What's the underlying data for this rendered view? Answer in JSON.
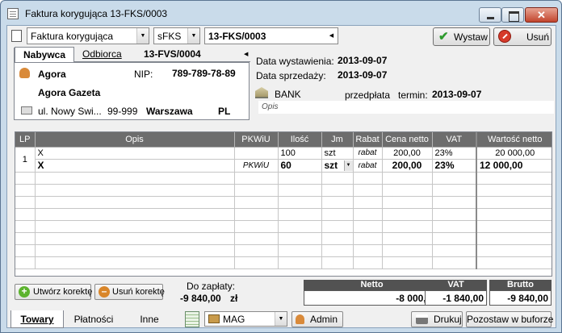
{
  "window": {
    "title": "Faktura korygująca 13-FKS/0003"
  },
  "toolbar": {
    "doc_type": "Faktura korygująca",
    "series": "sFKS",
    "number": "13-FKS/0003",
    "issue_label": "Wystaw",
    "cancel_label": "Usuń"
  },
  "party_tabs": {
    "buyer": "Nabywca",
    "recipient": "Odbiorca",
    "doc_ref": "13-FVS/0004"
  },
  "buyer": {
    "name": "Agora",
    "nip_label": "NIP:",
    "nip": "789-789-78-89",
    "full_name": "Agora Gazeta",
    "street": "ul. Nowy Swi...",
    "postcode": "99-999",
    "city": "Warszawa",
    "country": "PL"
  },
  "dates": {
    "issue_label": "Data wystawienia:",
    "issue_value": "2013-09-07",
    "sale_label": "Data sprzedaży:",
    "sale_value": "2013-09-07"
  },
  "payment": {
    "method": "BANK",
    "form": "przedpłata",
    "term_label": "termin:",
    "term_value": "2013-09-07",
    "desc_placeholder": "Opis"
  },
  "grid": {
    "headers": [
      "LP",
      "Opis",
      "PKWiU",
      "Ilość",
      "Jm",
      "Rabat",
      "Cena netto",
      "VAT",
      "Wartość netto"
    ],
    "row_lp": "1",
    "original": {
      "opis": "X",
      "pkwiu": "",
      "ilosc": "100",
      "jm": "szt",
      "rabat": "rabat",
      "cena": "200,00",
      "vat": "23%",
      "wartosc": "20 000,00"
    },
    "corrected": {
      "opis": "X",
      "pkwiu": "PKWiU",
      "ilosc": "60",
      "jm": "szt",
      "rabat": "rabat",
      "cena": "200,00",
      "vat": "23%",
      "wartosc": "12 000,00"
    }
  },
  "correction": {
    "create_label": "Utwórz korektę",
    "delete_label": "Usuń korektę"
  },
  "to_pay": {
    "label": "Do zapłaty:",
    "amount": "-9 840,00",
    "currency": "zł"
  },
  "summary": {
    "netto_label": "Netto",
    "netto_value": "-8 000,00",
    "vat_label": "VAT",
    "vat_value": "-1 840,00",
    "brutto_label": "Brutto",
    "brutto_value": "-9 840,00"
  },
  "bottom_tabs": {
    "items": "Towary",
    "payments": "Płatności",
    "other": "Inne"
  },
  "footer": {
    "warehouse": "MAG",
    "user": "Admin",
    "print_label": "Drukuj",
    "buffer_label": "Pozostaw w buforze"
  }
}
